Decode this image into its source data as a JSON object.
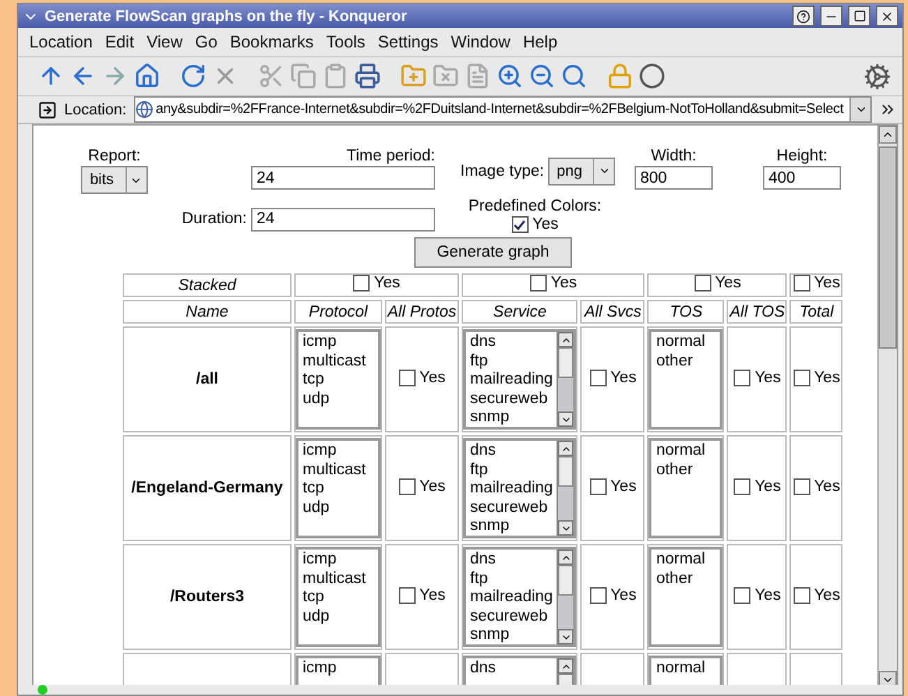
{
  "window": {
    "title": "Generate FlowScan graphs on the fly - Konqueror"
  },
  "menu": [
    "Location",
    "Edit",
    "View",
    "Go",
    "Bookmarks",
    "Tools",
    "Settings",
    "Window",
    "Help"
  ],
  "location_bar": {
    "label": "Location:",
    "url": "any&subdir=%2FFrance-Internet&subdir=%2FDuitsland-Internet&subdir=%2FBelgium-NotToHolland&submit=Select"
  },
  "form": {
    "report": {
      "label": "Report:",
      "value": "bits"
    },
    "time_period": {
      "label": "Time period:",
      "value": "24"
    },
    "image_type": {
      "label": "Image type:",
      "value": "png"
    },
    "width": {
      "label": "Width:",
      "value": "800"
    },
    "height": {
      "label": "Height:",
      "value": "400"
    },
    "duration": {
      "label": "Duration:",
      "value": "24"
    },
    "predefined_colors": {
      "label": "Predefined Colors:",
      "option": "Yes",
      "checked": true
    },
    "submit": "Generate graph"
  },
  "table": {
    "stacked_label": "Stacked",
    "stacked": [
      {
        "label": "Yes",
        "checked": false
      },
      {
        "label": "Yes",
        "checked": false
      },
      {
        "label": "Yes",
        "checked": false
      },
      {
        "label": "Yes",
        "checked": false
      }
    ],
    "columns": [
      "Name",
      "Protocol",
      "All Protos",
      "Service",
      "All Svcs",
      "TOS",
      "All TOS",
      "Total"
    ],
    "rows": [
      {
        "name": "/all",
        "protocols": [
          "icmp",
          "multicast",
          "tcp",
          "udp"
        ],
        "all_protos": {
          "label": "Yes",
          "checked": false
        },
        "services": [
          "dns",
          "ftp",
          "mailreading",
          "secureweb",
          "snmp"
        ],
        "all_svcs": {
          "label": "Yes",
          "checked": false
        },
        "tos": [
          "normal",
          "other"
        ],
        "all_tos": {
          "label": "Yes",
          "checked": false
        },
        "total": {
          "label": "Yes",
          "checked": false
        }
      },
      {
        "name": "/Engeland-Germany",
        "protocols": [
          "icmp",
          "multicast",
          "tcp",
          "udp"
        ],
        "all_protos": {
          "label": "Yes",
          "checked": false
        },
        "services": [
          "dns",
          "ftp",
          "mailreading",
          "secureweb",
          "snmp"
        ],
        "all_svcs": {
          "label": "Yes",
          "checked": false
        },
        "tos": [
          "normal",
          "other"
        ],
        "all_tos": {
          "label": "Yes",
          "checked": false
        },
        "total": {
          "label": "Yes",
          "checked": false
        }
      },
      {
        "name": "/Routers3",
        "protocols": [
          "icmp",
          "multicast",
          "tcp",
          "udp"
        ],
        "all_protos": {
          "label": "Yes",
          "checked": false
        },
        "services": [
          "dns",
          "ftp",
          "mailreading",
          "secureweb",
          "snmp"
        ],
        "all_svcs": {
          "label": "Yes",
          "checked": false
        },
        "tos": [
          "normal",
          "other"
        ],
        "all_tos": {
          "label": "Yes",
          "checked": false
        },
        "total": {
          "label": "Yes",
          "checked": false
        }
      },
      {
        "protocols": [
          "icmp"
        ],
        "services": [
          "dns"
        ],
        "tos": [
          "normal"
        ]
      }
    ]
  }
}
